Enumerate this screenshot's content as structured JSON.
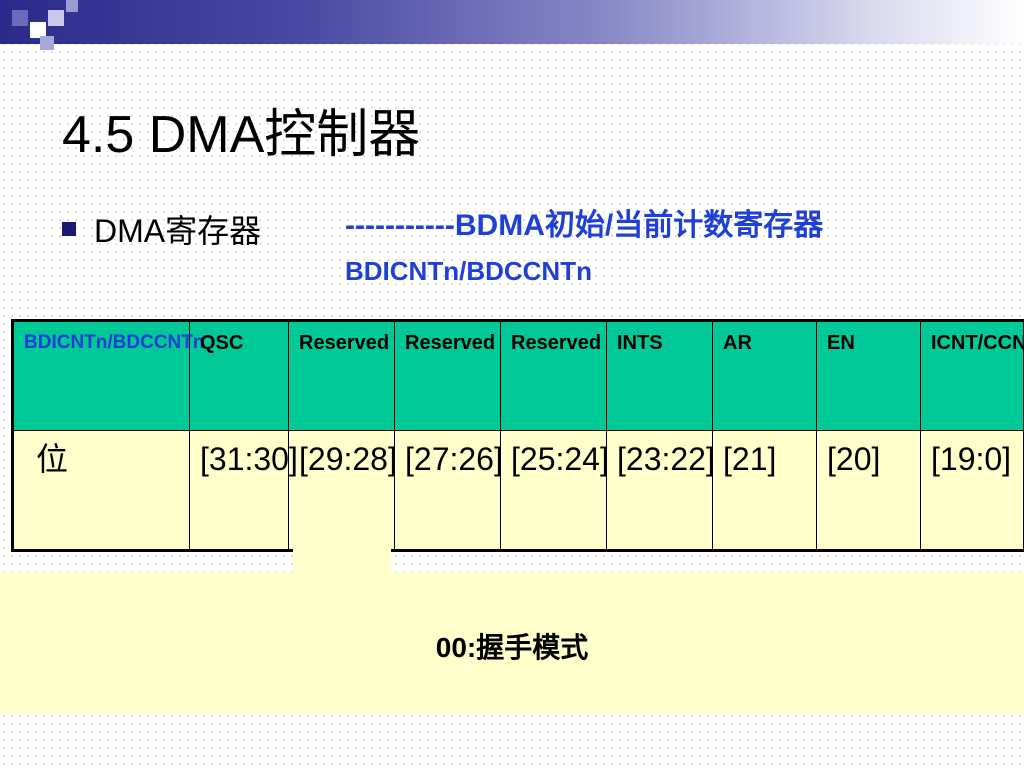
{
  "slide": {
    "title": "4.5  DMA控制器",
    "bullet": "DMA寄存器",
    "subtitle_line1": "-----------BDMA初始/当前计数寄存器",
    "subtitle_line2": "BDICNTn/BDCCNTn"
  },
  "table": {
    "headers": [
      "BDICNTn/BDCCNTn",
      "QSC",
      "Reserved",
      "Reserved",
      "Reserved",
      "INTS",
      "AR",
      "EN",
      "ICNT/CCNT"
    ],
    "bits": [
      "位",
      "[31:30]",
      "[29:28]",
      "[27:26]",
      "[25:24]",
      "[23:22]",
      "[21]",
      "[20]",
      "[19:0]"
    ]
  },
  "callout": {
    "text": "00:握手模式"
  },
  "colors": {
    "header_bg": "#00c896",
    "row_bg": "#ffffcc",
    "accent_blue": "#1f3fd6",
    "banner": "#2a2a8a"
  }
}
